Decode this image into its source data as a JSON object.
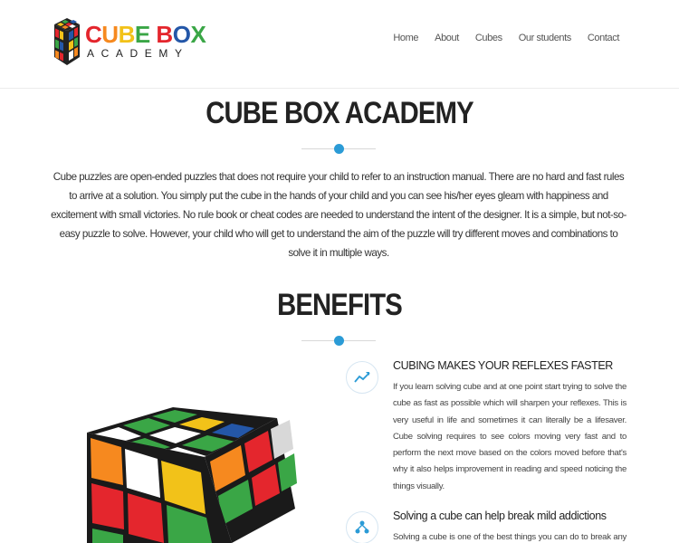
{
  "brand": {
    "name_top": "CUBE BOX",
    "name_bottom": "ACADEMY",
    "colors": {
      "red": "#e4262d",
      "orange": "#f6891f",
      "yellow": "#f2c219",
      "green": "#3aa646",
      "blue": "#2457a8"
    }
  },
  "nav": {
    "items": [
      "Home",
      "About",
      "Cubes",
      "Our students",
      "Contact"
    ]
  },
  "hero": {
    "title": "CUBE BOX ACADEMY",
    "text": "Cube puzzles are open-ended puzzles that does not require your child to refer to an instruction manual. There are no hard and fast rules to arrive at a solution. You simply put the cube in the hands of your child and you can see his/her eyes gleam with happiness and excitement with small victories. No rule book or cheat codes are needed to understand the intent of the designer. It is a simple, but not-so-easy puzzle to solve. However, your child who will get to understand the aim of the puzzle will try different moves and combinations to solve it in multiple ways."
  },
  "benefits": {
    "title": "BENEFITS",
    "items": [
      {
        "icon": "trend-chart-icon",
        "title": "CUBING MAKES YOUR REFLEXES FASTER",
        "text": "If you learn solving cube and at one point start trying to solve the cube as fast as possible which will sharpen your reflexes. This is very useful in life and sometimes it can literally be a lifesaver. Cube solving requires to see colors moving very fast and to perform the next move based on the colors moved before that's why it also helps improvement in reading and speed noticing the things visually."
      },
      {
        "icon": "network-icon",
        "title": "Solving a cube can help break mild addictions",
        "text": "Solving a cube is one of the best things you can do to break any mild"
      }
    ]
  },
  "accent_color": "#2b9bd6"
}
